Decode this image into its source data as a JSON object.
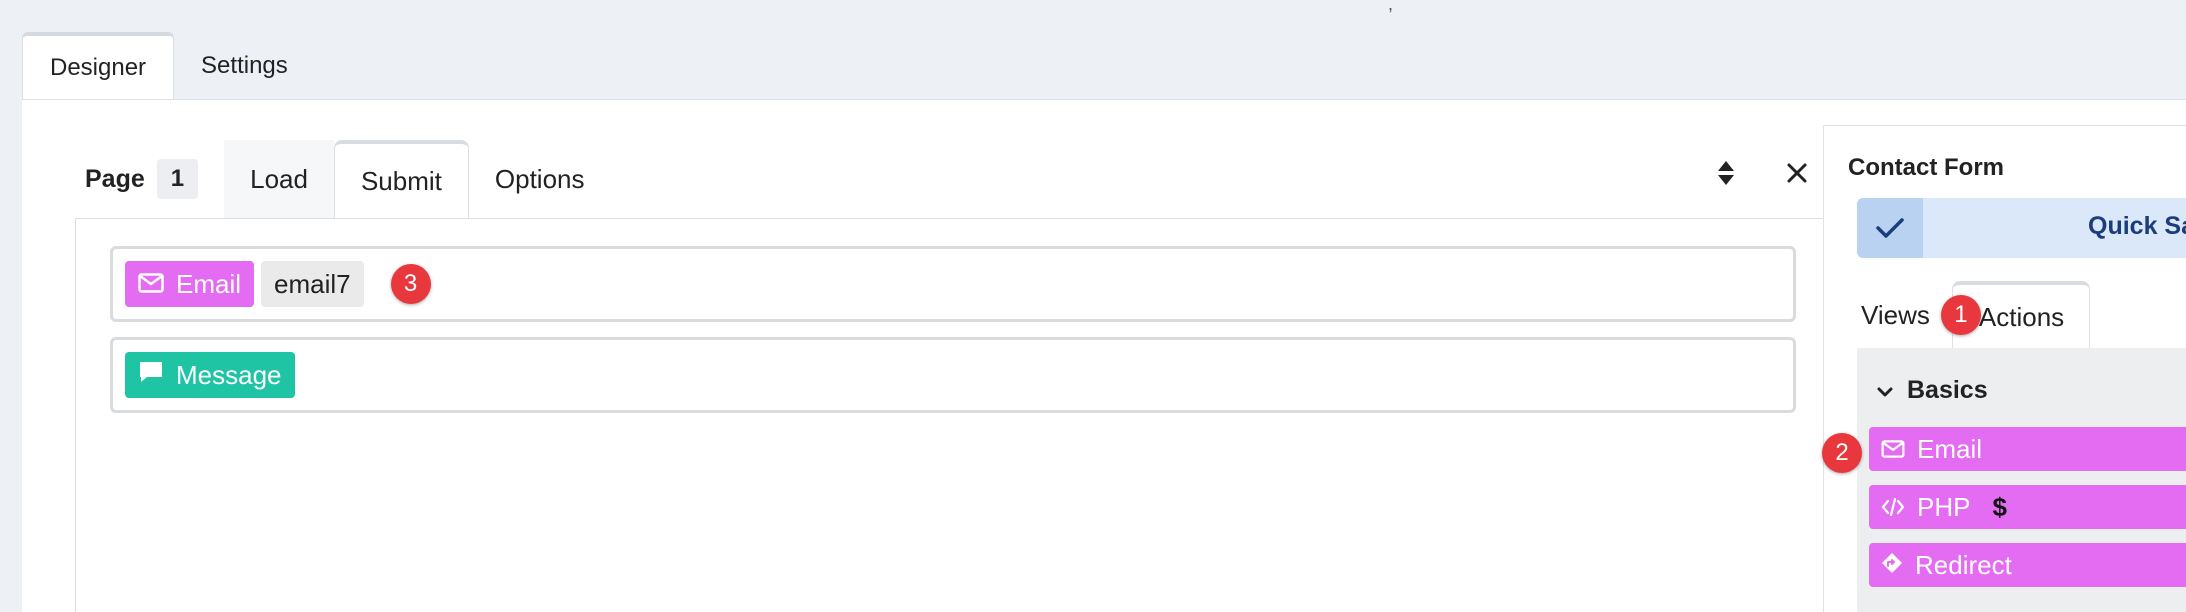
{
  "top_tabs": {
    "designer": "Designer",
    "settings": "Settings"
  },
  "page": {
    "label": "Page",
    "number": "1"
  },
  "sub_tabs": {
    "load": "Load",
    "submit": "Submit",
    "options": "Options"
  },
  "rows": [
    {
      "tag_label": "Email",
      "name": "email7",
      "badge": "3"
    },
    {
      "tag_label": "Message"
    }
  ],
  "sidebar": {
    "form_title": "Contact Form",
    "quick_label": "Quick Sa",
    "tabs": {
      "views": "Views",
      "actions": "Actions",
      "actions_badge": "1"
    },
    "group_title": "Basics",
    "actions": [
      {
        "label": "Email",
        "icon": "envelope-icon",
        "badge": "2"
      },
      {
        "label": "PHP",
        "icon": "code-icon",
        "extra": "$"
      },
      {
        "label": "Redirect",
        "icon": "directions-icon"
      }
    ]
  },
  "colors": {
    "email_tag": "#e46cf3",
    "message_tag": "#1ec4a4",
    "badge": "#e8383d",
    "quick_bar": "#dbe8fa",
    "quick_text": "#1b3d7a"
  }
}
